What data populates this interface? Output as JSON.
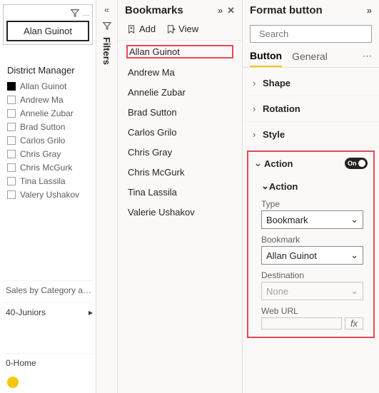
{
  "canvas": {
    "button_header_dots": "…",
    "button_text": "Alan Guinot",
    "slicer_title": "District Manager",
    "slicer_items": [
      {
        "label": "Allan Guinot",
        "selected": true
      },
      {
        "label": "Andrew Ma",
        "selected": false
      },
      {
        "label": "Annelie Zubar",
        "selected": false
      },
      {
        "label": "Brad Sutton",
        "selected": false
      },
      {
        "label": "Carlos Grilo",
        "selected": false
      },
      {
        "label": "Chris Gray",
        "selected": false
      },
      {
        "label": "Chris McGurk",
        "selected": false
      },
      {
        "label": "Tina Lassila",
        "selected": false
      },
      {
        "label": "Valery Ushakov",
        "selected": false
      }
    ],
    "mini1": "Sales by Category a…",
    "mini2": "40-Juniors",
    "mini3": "0-Home"
  },
  "filters_rail": {
    "label": "Filters"
  },
  "bookmarks": {
    "title": "Bookmarks",
    "add_label": "Add",
    "view_label": "View",
    "items": [
      "Allan Guinot",
      "Andrew Ma",
      "Annelie Zubar",
      "Brad Sutton",
      "Carlos Grilo",
      "Chris Gray",
      "Chris McGurk",
      "Tina Lassila",
      "Valerie Ushakov"
    ]
  },
  "format": {
    "title": "Format button",
    "search_placeholder": "Search",
    "tabs": {
      "button": "Button",
      "general": "General"
    },
    "sections": {
      "shape": "Shape",
      "rotation": "Rotation",
      "style": "Style"
    },
    "action": {
      "header": "Action",
      "toggle_text": "On",
      "sub_header": "Action",
      "type_label": "Type",
      "type_value": "Bookmark",
      "bookmark_label": "Bookmark",
      "bookmark_value": "Allan Guinot",
      "destination_label": "Destination",
      "destination_value": "None",
      "weburl_label": "Web URL",
      "fx_label": "fx"
    }
  }
}
